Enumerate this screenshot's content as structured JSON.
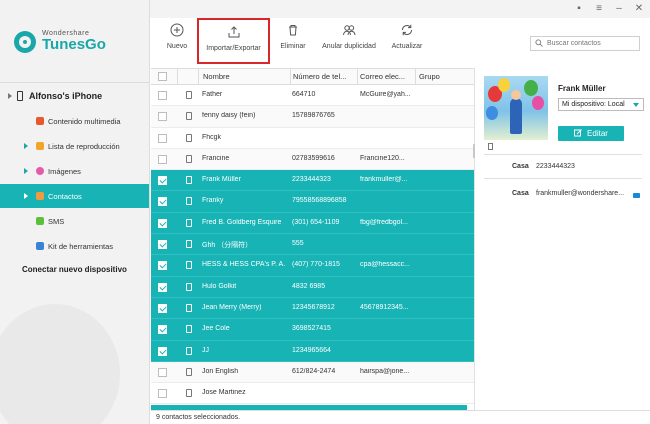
{
  "app": {
    "brand": "Wondershare",
    "product": "TunesGo"
  },
  "sidebar": {
    "device_name": "Alfonso's iPhone",
    "items": [
      {
        "label": "Contenido multimedia",
        "icon": "media-icon",
        "color": "#e8582c",
        "expandable": false
      },
      {
        "label": "Lista de reproducción",
        "icon": "playlist-icon",
        "color": "#f2a52b",
        "expandable": true
      },
      {
        "label": "Imágenes",
        "icon": "photos-icon",
        "color": "#e45baa",
        "expandable": true
      },
      {
        "label": "Contactos",
        "icon": "contacts-icon",
        "color": "#f09a3e",
        "expandable": true,
        "active": true
      },
      {
        "label": "SMS",
        "icon": "sms-icon",
        "color": "#5bbf3b",
        "expandable": false
      },
      {
        "label": "Kit de herramientas",
        "icon": "toolkit-icon",
        "color": "#3a82d6",
        "expandable": false
      }
    ],
    "connect_label": "Conectar nuevo dispositivo"
  },
  "toolbar": {
    "buttons": [
      {
        "label": "Nuevo",
        "icon": "plus-circle-icon"
      },
      {
        "label": "Importar/Exportar",
        "icon": "import-export-icon",
        "highlighted": true
      },
      {
        "label": "Eliminar",
        "icon": "trash-icon"
      },
      {
        "label": "Anular duplicidad",
        "icon": "merge-contacts-icon"
      },
      {
        "label": "Actualizar",
        "icon": "refresh-icon"
      }
    ],
    "search_placeholder": "Buscar contactos"
  },
  "table": {
    "columns": [
      "Nombre",
      "Número de tel...",
      "Correo elec...",
      "Grupo"
    ],
    "rows": [
      {
        "name": "Father",
        "phone": "664710",
        "email": "McGuire@yah...",
        "selected": false
      },
      {
        "name": "fenny daisy (fein)",
        "phone": "15789876765",
        "email": "",
        "selected": false
      },
      {
        "name": "Fhcgk",
        "phone": "",
        "email": "",
        "selected": false
      },
      {
        "name": "Francine",
        "phone": "02783599616",
        "email": "Francine120...",
        "selected": false
      },
      {
        "name": "Frank Müller",
        "phone": "2233444323",
        "email": "frankmuller@...",
        "selected": true
      },
      {
        "name": "Franky",
        "phone": "79558568896858",
        "email": "",
        "selected": true
      },
      {
        "name": "Fred B. Goldberg Esquire",
        "phone": "(301) 654-1109",
        "email": "fbg@fredbgol...",
        "selected": true
      },
      {
        "name": "Ghh （分隔符）",
        "phone": "555",
        "email": "",
        "selected": true
      },
      {
        "name": "HESS & HESS CPA's P. A.",
        "phone": "(407) 770-1815",
        "email": "cpa@hessacc...",
        "selected": true
      },
      {
        "name": "Hulo Golkit",
        "phone": "4832 6985",
        "email": "",
        "selected": true
      },
      {
        "name": "Jean Merry (Merry)",
        "phone": "12345678912",
        "email": "45678912345...",
        "selected": true
      },
      {
        "name": "Jee Cole",
        "phone": "3698527415",
        "email": "",
        "selected": true
      },
      {
        "name": "JJ",
        "phone": "1234965664",
        "email": "",
        "selected": true
      },
      {
        "name": "Jon English",
        "phone": "612/824-2474",
        "email": "hairspa@jone...",
        "selected": false
      },
      {
        "name": "Jose Martinez",
        "phone": "",
        "email": "",
        "selected": false
      }
    ]
  },
  "status": {
    "text": "9 contactos seleccionados."
  },
  "detail": {
    "name": "Frank Müller",
    "device_select": "Mi dispositivo: Local",
    "edit_label": "Editar",
    "fields": [
      {
        "key": "Casa",
        "value": "2233444323",
        "type": "phone"
      },
      {
        "key": "Casa",
        "value": "frankmuller@wondershare...",
        "type": "email"
      }
    ]
  },
  "colors": {
    "accent": "#18b3b5",
    "highlight_border": "#d9262a"
  }
}
